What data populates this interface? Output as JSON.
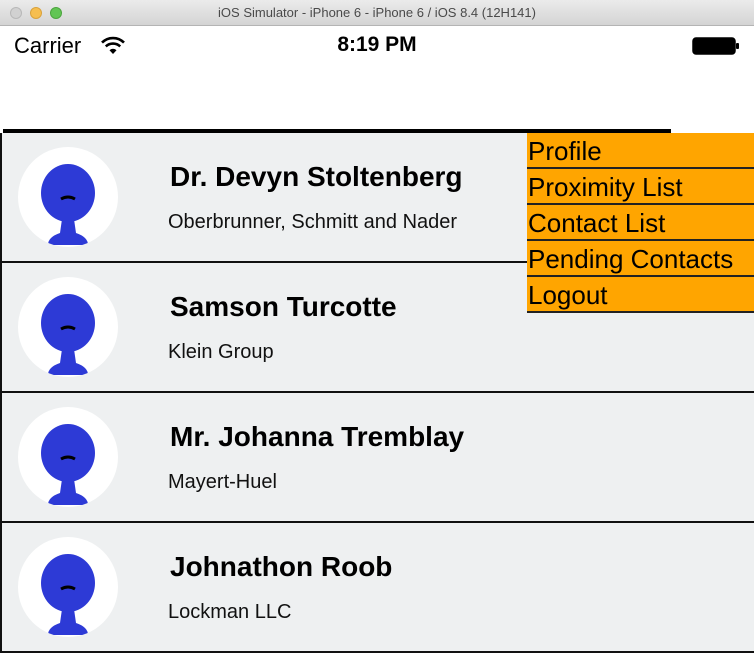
{
  "window": {
    "title": "iOS Simulator - iPhone 6 - iPhone 6 / iOS 8.4 (12H141)"
  },
  "statusbar": {
    "carrier": "Carrier",
    "time": "8:19 PM",
    "icons": [
      "wifi-icon",
      "battery-icon"
    ]
  },
  "menu": {
    "color": "#ffa500",
    "items": [
      {
        "label": "Profile"
      },
      {
        "label": "Proximity List"
      },
      {
        "label": "Contact List"
      },
      {
        "label": "Pending Contacts"
      },
      {
        "label": "Logout"
      }
    ]
  },
  "contacts": [
    {
      "name": "Dr. Devyn Stoltenberg",
      "company": "Oberbrunner, Schmitt and Nader"
    },
    {
      "name": "Samson Turcotte",
      "company": "Klein Group"
    },
    {
      "name": "Mr. Johanna Tremblay",
      "company": "Mayert-Huel"
    },
    {
      "name": "Johnathon Roob",
      "company": "Lockman LLC"
    }
  ],
  "colors": {
    "avatar_figure": "#2d3ad6",
    "row_background": "#eef0f1"
  }
}
